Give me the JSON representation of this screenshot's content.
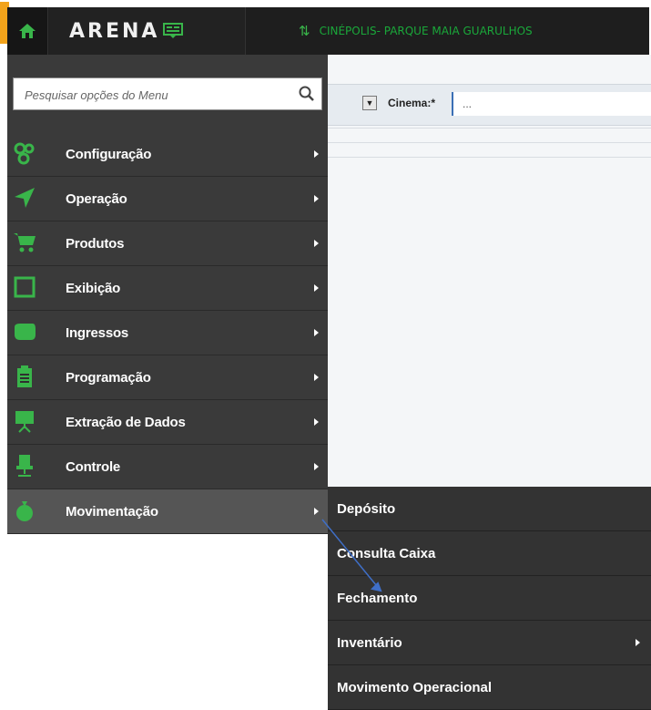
{
  "topbar": {
    "brand": "ARENA",
    "cinema_name": "CINÉPOLIS- PARQUE MAIA GUARULHOS"
  },
  "search": {
    "placeholder": "Pesquisar opções do Menu"
  },
  "filter": {
    "cinema_label": "Cinema:*",
    "cinema_value": "..."
  },
  "menu": {
    "items": [
      {
        "label": "Configuração",
        "icon": "gears-icon"
      },
      {
        "label": "Operação",
        "icon": "send-arrow-icon"
      },
      {
        "label": "Produtos",
        "icon": "cart-icon"
      },
      {
        "label": "Exibição",
        "icon": "screen-frame-icon"
      },
      {
        "label": "Ingressos",
        "icon": "ticket-icon"
      },
      {
        "label": "Programação",
        "icon": "clipboard-icon"
      },
      {
        "label": "Extração de Dados",
        "icon": "presentation-board-icon"
      },
      {
        "label": "Controle",
        "icon": "chair-icon"
      },
      {
        "label": "Movimentação",
        "icon": "money-bag-icon"
      }
    ]
  },
  "submenu": {
    "items": [
      {
        "label": "Depósito"
      },
      {
        "label": "Consulta Caixa"
      },
      {
        "label": "Fechamento"
      },
      {
        "label": "Inventário"
      },
      {
        "label": "Movimento Operacional"
      }
    ]
  },
  "colors": {
    "icon_green": "#39b54a",
    "cinema_green": "#1aa83a",
    "sidebar_bg": "#3a3a3a",
    "active_bg": "#555555",
    "accent_orange": "#f2a31b",
    "arrow_blue": "#3f6fc8"
  }
}
